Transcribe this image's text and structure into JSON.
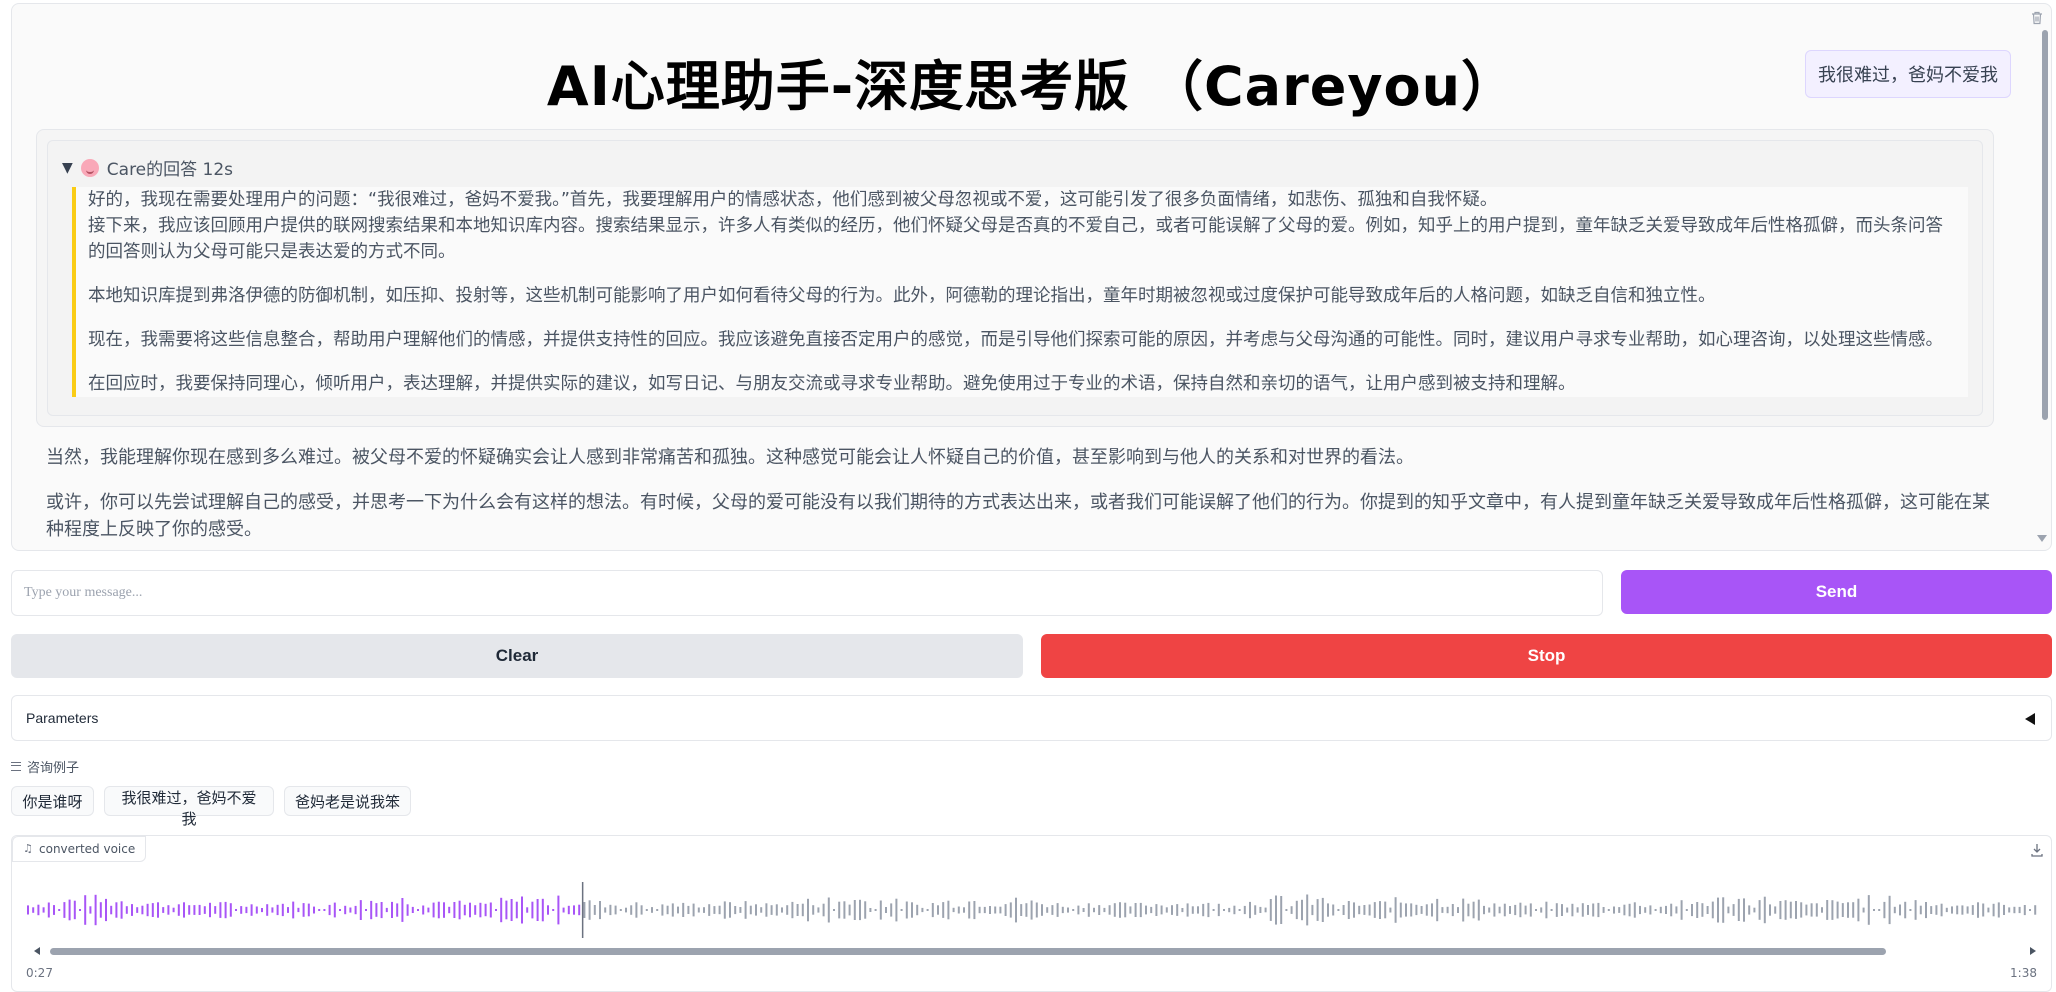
{
  "header": {
    "title": "AI心理助手-深度思考版 （Careyou）"
  },
  "chat": {
    "user_message": "我很难过，爸妈不爱我",
    "thinking": {
      "summary": "Care的回答 12s",
      "paragraphs": [
        "好的，我现在需要处理用户的问题：“我很难过，爸妈不爱我。”首先，我要理解用户的情感状态，他们感到被父母忽视或不爱，这可能引发了很多负面情绪，如悲伤、孤独和自我怀疑。",
        "接下来，我应该回顾用户提供的联网搜索结果和本地知识库内容。搜索结果显示，许多人有类似的经历，他们怀疑父母是否真的不爱自己，或者可能误解了父母的爱。例如，知乎上的用户提到，童年缺乏关爱导致成年后性格孤僻，而头条问答的回答则认为父母可能只是表达爱的方式不同。",
        "本地知识库提到弗洛伊德的防御机制，如压抑、投射等，这些机制可能影响了用户如何看待父母的行为。此外，阿德勒的理论指出，童年时期被忽视或过度保护可能导致成年后的人格问题，如缺乏自信和独立性。",
        "现在，我需要将这些信息整合，帮助用户理解他们的情感，并提供支持性的回应。我应该避免直接否定用户的感觉，而是引导他们探索可能的原因，并考虑与父母沟通的可能性。同时，建议用户寻求专业帮助，如心理咨询，以处理这些情感。",
        "在回应时，我要保持同理心，倾听用户，表达理解，并提供实际的建议，如写日记、与朋友交流或寻求专业帮助。避免使用过于专业的术语，保持自然和亲切的语气，让用户感到被支持和理解。"
      ]
    },
    "answer_paragraphs": [
      "当然，我能理解你现在感到多么难过。被父母不爱的怀疑确实会让人感到非常痛苦和孤独。这种感觉可能会让人怀疑自己的价值，甚至影响到与他人的关系和对世界的看法。",
      "或许，你可以先尝试理解自己的感受，并思考一下为什么会有这样的想法。有时候，父母的爱可能没有以我们期待的方式表达出来，或者我们可能误解了他们的行为。你提到的知乎文章中，有人提到童年缺乏关爱导致成年后性格孤僻，这可能在某种程度上反映了你的感受。"
    ]
  },
  "input": {
    "placeholder": "Type your message..."
  },
  "buttons": {
    "send": "Send",
    "clear": "Clear",
    "stop": "Stop"
  },
  "parameters": {
    "label": "Parameters"
  },
  "examples": {
    "label": "咨询例子",
    "items": [
      "你是谁呀",
      "我很难过，爸妈不爱我",
      "爸妈老是说我笨"
    ]
  },
  "audio": {
    "label": "converted voice",
    "current_time": "0:27",
    "duration": "1:38",
    "progress": 0.276,
    "played_color": "#a855f7",
    "unplayed_color": "#9ca3af"
  },
  "colors": {
    "accent": "#a855f7",
    "stop": "#ef4444",
    "clear": "#e5e7eb",
    "think_border": "#facc15"
  }
}
